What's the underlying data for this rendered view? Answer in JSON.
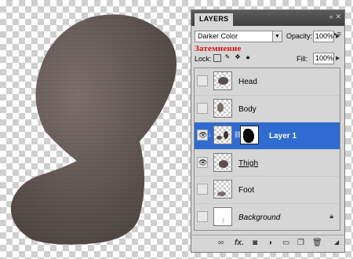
{
  "panel": {
    "tab_label": "LAYERS",
    "collapse_icon": "double-chevron-left-icon",
    "close_icon": "close-icon",
    "menu_icon": "panel-menu-icon"
  },
  "blend": {
    "mode": "Darker Color",
    "overlay_note": "Затемнение"
  },
  "opacity": {
    "label": "Opacity:",
    "value": "100%"
  },
  "lock": {
    "label": "Lock:"
  },
  "fill": {
    "label": "Fill:",
    "value": "100%"
  },
  "layers": [
    {
      "name": "Head",
      "visible": false,
      "selected": false,
      "style": "normal"
    },
    {
      "name": "Body",
      "visible": false,
      "selected": false,
      "style": "normal"
    },
    {
      "name": "Layer 1",
      "visible": true,
      "selected": true,
      "style": "bold"
    },
    {
      "name": "Thigh",
      "visible": true,
      "selected": false,
      "style": "underline"
    },
    {
      "name": "Foot",
      "visible": false,
      "selected": false,
      "style": "normal"
    },
    {
      "name": "Background",
      "visible": false,
      "selected": false,
      "style": "italic",
      "locked": true
    }
  ],
  "bottom_icons": [
    "link-layers-icon",
    "fx-icon",
    "add-mask-icon",
    "adjustment-layer-icon",
    "new-group-icon",
    "new-layer-icon",
    "trash-icon"
  ],
  "colors": {
    "selection": "#2f6bd0",
    "panel_bg": "#d6d6d6",
    "overlay_text": "#d81515"
  }
}
